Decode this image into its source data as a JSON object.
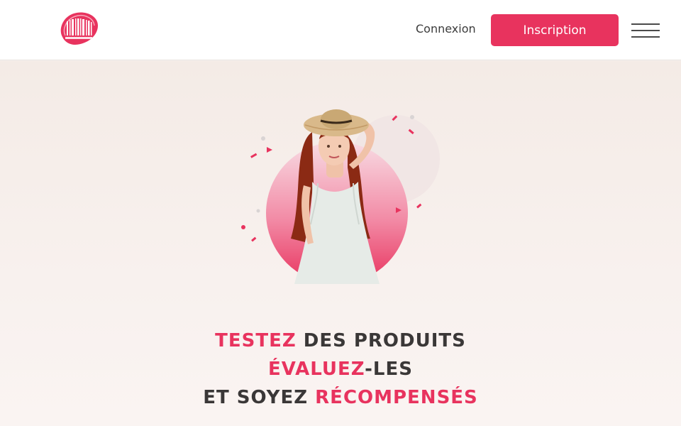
{
  "header": {
    "logo_icon": "barcode-logo-icon",
    "login_label": "Connexion",
    "signup_label": "Inscription",
    "menu_icon": "hamburger-menu-icon"
  },
  "hero": {
    "image": "woman-in-white-dress-with-straw-hat",
    "headline": {
      "line1_accent": "TESTEZ",
      "line1_rest": " DES PRODUITS",
      "line2_accent": "ÉVALUEZ",
      "line2_rest": "-LES",
      "line3_start": "ET SOYEZ ",
      "line3_accent": "RÉCOMPENSÉS"
    }
  },
  "colors": {
    "accent": "#e8335e",
    "text_dark": "#3a3737",
    "background": "#f7f1ee"
  }
}
